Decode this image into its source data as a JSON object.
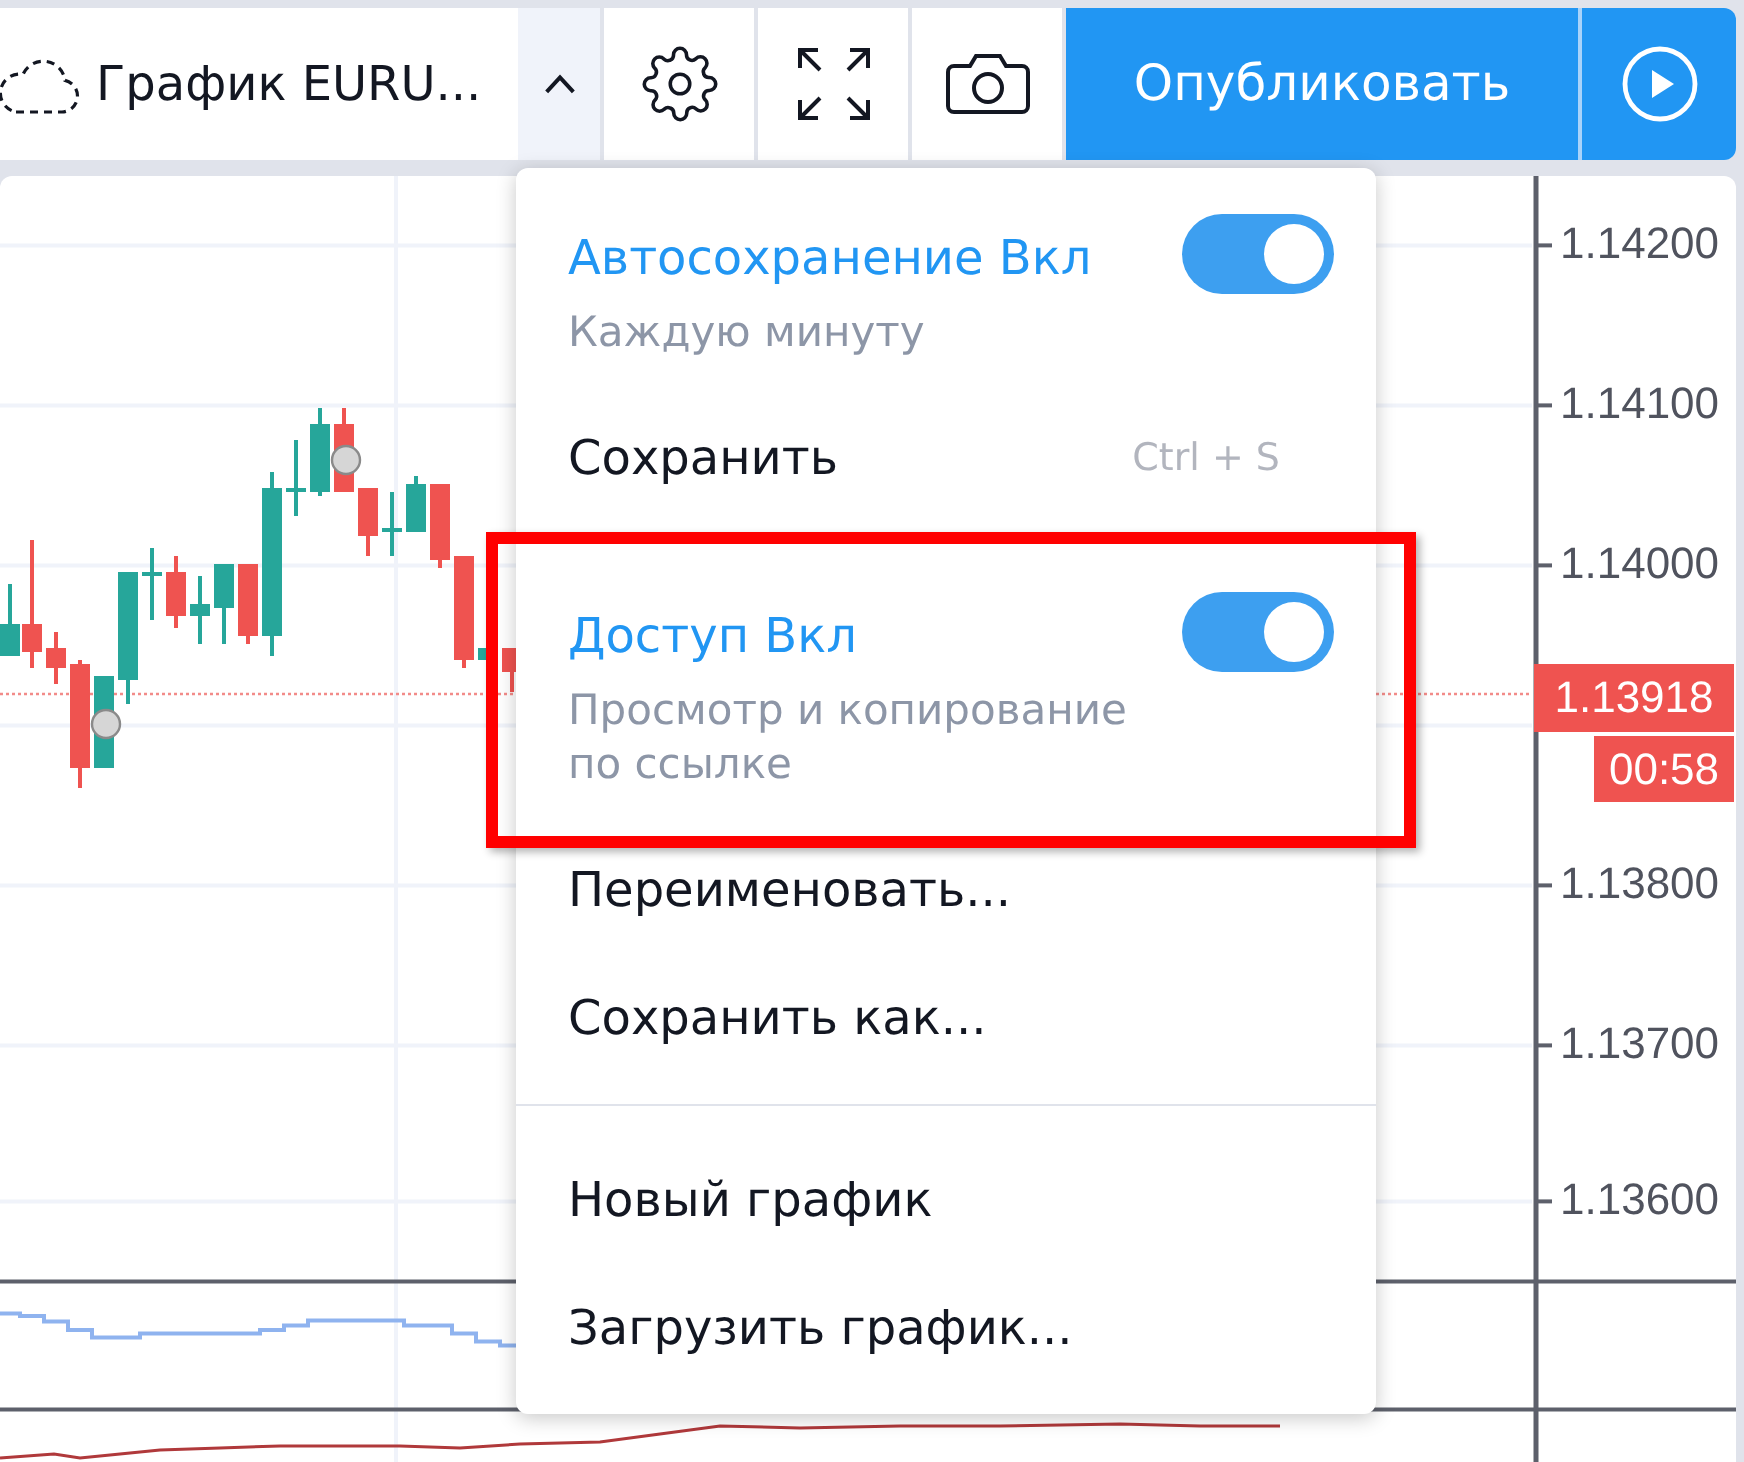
{
  "toolbar": {
    "chart_name": "График EURU...",
    "menu_button": {
      "expanded": true
    },
    "publish_button": "Опубликовать"
  },
  "chart": {
    "price_labels": [
      "1.14200",
      "1.14100",
      "1.14000",
      "1.13800",
      "1.13700",
      "1.13600"
    ],
    "last_price": "1.13918",
    "countdown": "00:58"
  },
  "menu": {
    "items": [
      {
        "kind": "toggle",
        "label": "Автосохранение Вкл",
        "description": "Каждую минуту",
        "on": true,
        "highlighted": false
      },
      {
        "kind": "action",
        "label": "Сохранить",
        "shortcut": "Ctrl + S",
        "highlighted": false
      },
      {
        "kind": "toggle",
        "label": "Доступ Вкл",
        "description": "Просмотр и копирование по ссылке",
        "on": true,
        "highlighted": true
      },
      {
        "kind": "action",
        "label": "Переименовать...",
        "highlighted": false
      },
      {
        "kind": "action",
        "label": "Сохранить как...",
        "highlighted": false
      },
      {
        "kind": "divider"
      },
      {
        "kind": "action",
        "label": "Новый график",
        "highlighted": false
      },
      {
        "kind": "action",
        "label": "Загрузить график...",
        "highlighted": false
      }
    ]
  }
}
